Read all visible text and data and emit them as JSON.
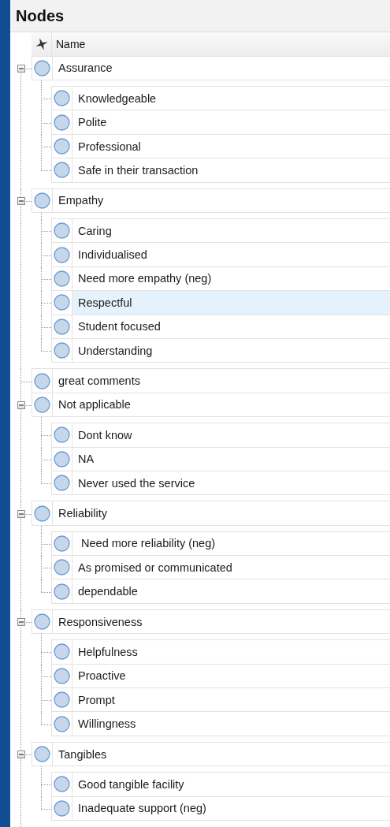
{
  "panel": {
    "title": "Nodes"
  },
  "columns": [
    {
      "label": "Name"
    }
  ],
  "nodes": [
    {
      "name": "Assurance",
      "selected": false,
      "expanded": true,
      "children": [
        {
          "name": "Knowledgeable",
          "selected": false
        },
        {
          "name": "Polite",
          "selected": false
        },
        {
          "name": "Professional",
          "selected": false
        },
        {
          "name": "Safe in their transaction",
          "selected": false
        }
      ]
    },
    {
      "name": "Empathy",
      "selected": false,
      "expanded": true,
      "children": [
        {
          "name": "Caring",
          "selected": false
        },
        {
          "name": "Individualised",
          "selected": false
        },
        {
          "name": "Need more empathy (neg)",
          "selected": false
        },
        {
          "name": "Respectful",
          "selected": true
        },
        {
          "name": "Student focused",
          "selected": false
        },
        {
          "name": "Understanding",
          "selected": false
        }
      ]
    },
    {
      "name": "great comments",
      "selected": false
    },
    {
      "name": "Not applicable",
      "selected": false,
      "expanded": true,
      "children": [
        {
          "name": "Dont know",
          "selected": false
        },
        {
          "name": "NA",
          "selected": false
        },
        {
          "name": "Never used the service",
          "selected": false
        }
      ]
    },
    {
      "name": "Reliability",
      "selected": false,
      "expanded": true,
      "children": [
        {
          "name": " Need more reliability (neg)",
          "selected": false
        },
        {
          "name": "As promised or communicated",
          "selected": false
        },
        {
          "name": "dependable",
          "selected": false
        }
      ]
    },
    {
      "name": "Responsiveness",
      "selected": false,
      "expanded": true,
      "children": [
        {
          "name": "Helpfulness",
          "selected": false
        },
        {
          "name": "Proactive",
          "selected": false
        },
        {
          "name": "Prompt",
          "selected": false
        },
        {
          "name": "Willingness",
          "selected": false
        }
      ]
    },
    {
      "name": "Tangibles",
      "selected": false,
      "expanded": true,
      "children": [
        {
          "name": "Good tangible facility",
          "selected": false
        },
        {
          "name": "Inadequate support (neg)",
          "selected": false
        }
      ]
    }
  ]
}
